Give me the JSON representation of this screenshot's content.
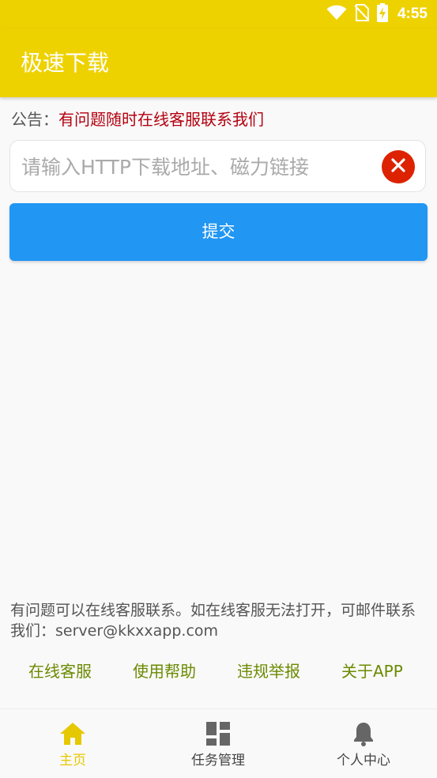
{
  "status_bar": {
    "time": "4:55",
    "icons": [
      "wifi-icon",
      "no-sim-icon",
      "battery-charging-icon"
    ]
  },
  "app_bar": {
    "title": "极速下载"
  },
  "notice": {
    "label": "公告：",
    "text": "有问题随时在线客服联系我们"
  },
  "url_input": {
    "placeholder": "请输入HTTP下载地址、磁力链接",
    "value": "",
    "clear_icon": "close-circle-icon"
  },
  "submit_button": {
    "label": "提交"
  },
  "contact": {
    "text": "有问题可以在线客服联系。如在线客服无法打开，可邮件联系我们：server@kkxxapp.com"
  },
  "links": [
    {
      "label": "在线客服"
    },
    {
      "label": "使用帮助"
    },
    {
      "label": "违规举报"
    },
    {
      "label": "关于APP"
    }
  ],
  "bottom_nav": {
    "items": [
      {
        "label": "主页",
        "icon": "home-icon",
        "active": true
      },
      {
        "label": "任务管理",
        "icon": "dashboard-icon",
        "active": false
      },
      {
        "label": "个人中心",
        "icon": "bell-icon",
        "active": false
      }
    ]
  },
  "colors": {
    "brand_yellow": "#eed200",
    "submit_blue": "#2196f3",
    "notice_red": "#b3000f",
    "link_green": "#6b8a00",
    "nav_active": "#e6c800",
    "nav_inactive": "#666666",
    "clear_red": "#dd2200"
  }
}
